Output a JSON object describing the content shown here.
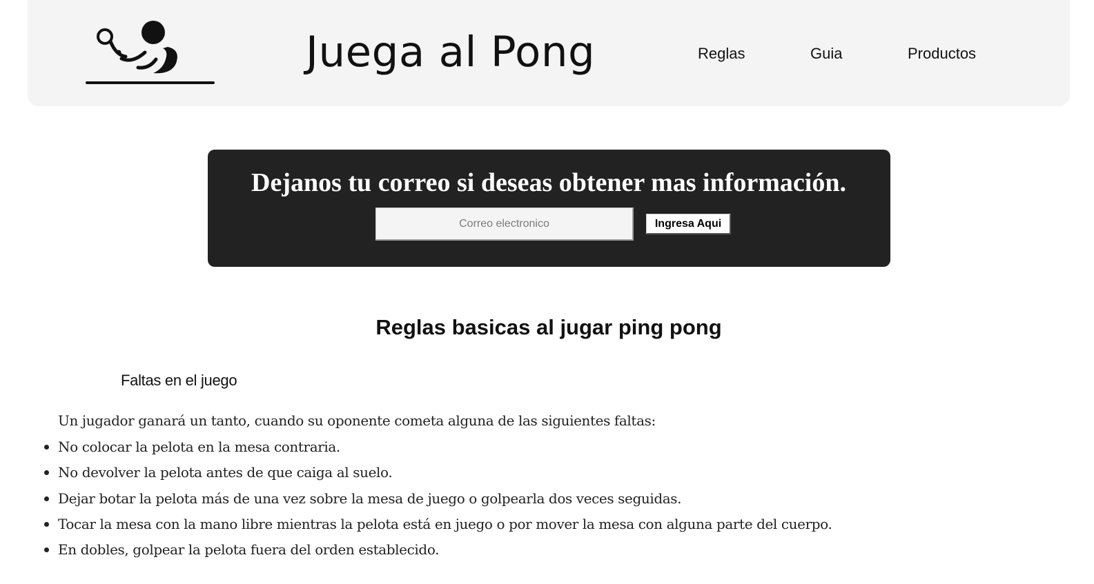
{
  "header": {
    "site_title": "Juega al Pong",
    "nav": [
      {
        "label": "Reglas"
      },
      {
        "label": "Guia"
      },
      {
        "label": "Productos"
      }
    ]
  },
  "newsletter": {
    "title": "Dejanos tu correo si deseas obtener mas información.",
    "email_placeholder": "Correo electronico",
    "email_value": "",
    "submit_label": "Ingresa Aqui"
  },
  "rules": {
    "title": "Reglas basicas al jugar ping pong",
    "subsection_title": "Faltas en el juego",
    "intro": "Un jugador ganará un tanto, cuando su oponente cometa alguna de las siguientes faltas:",
    "items": [
      {
        "text": "No colocar la pelota en la mesa contraria."
      },
      {
        "text": "No devolver la pelota antes de que caiga al suelo."
      },
      {
        "text": "Dejar botar la pelota más de una vez sobre la mesa de juego o golpearla dos veces seguidas."
      },
      {
        "text": "Tocar la mesa con la mano libre mientras la pelota está en juego o por mover la mesa con alguna parte del cuerpo."
      },
      {
        "text": "En dobles, golpear la pelota fuera del orden establecido."
      }
    ]
  },
  "icons": {
    "logo": "ping-pong-player-logo-icon",
    "bullet": "bullet-dot-icon"
  },
  "colors": {
    "header_bg": "#f4f4f4",
    "banner_bg": "#222222",
    "text": "#111111"
  }
}
